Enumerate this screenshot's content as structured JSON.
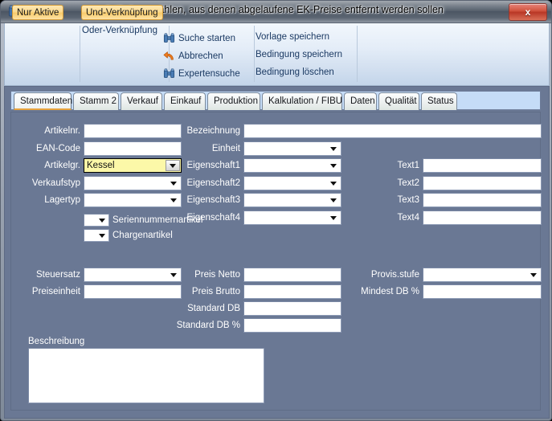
{
  "window": {
    "title": "Artikel auswählen, aus denen abgelaufene EK-Preise entfernt werden sollen",
    "app_icon": "binoculars-icon",
    "close_label": "x"
  },
  "ribbon": {
    "toggles": {
      "nur_aktive": "Nur Aktive",
      "und_verknuepfung": "Und-Verknüpfung",
      "oder_verknuepfung": "Oder-Verknüpfung"
    },
    "actions": [
      {
        "label": "Suche starten",
        "icon": "binoculars-icon"
      },
      {
        "label": "Abbrechen",
        "icon": "undo-arrow-icon"
      },
      {
        "label": "Expertensuche",
        "icon": "binoculars-icon"
      }
    ],
    "links": [
      {
        "label": "Vorlage speichern"
      },
      {
        "label": "Bedingung speichern"
      },
      {
        "label": "Bedingung löschen"
      }
    ]
  },
  "tabs": [
    {
      "label": "Stammdaten",
      "active": true
    },
    {
      "label": "Stamm 2",
      "active": false
    },
    {
      "label": "Verkauf",
      "active": false
    },
    {
      "label": "Einkauf",
      "active": false
    },
    {
      "label": "Produktion",
      "active": false
    },
    {
      "label": "Kalkulation / FIBU",
      "active": false
    },
    {
      "label": "Daten",
      "active": false
    },
    {
      "label": "Qualität",
      "active": false
    },
    {
      "label": "Status",
      "active": false
    }
  ],
  "form": {
    "col_left": [
      {
        "label": "Artikelnr.",
        "type": "text",
        "value": ""
      },
      {
        "label": "EAN-Code",
        "type": "text",
        "value": ""
      },
      {
        "label": "Artikelgr.",
        "type": "combo",
        "value": "Kessel",
        "highlighted": true
      },
      {
        "label": "Verkaufstyp",
        "type": "combo",
        "value": ""
      },
      {
        "label": "Lagertyp",
        "type": "combo",
        "value": ""
      }
    ],
    "flag_combos": [
      {
        "label": "Seriennummernartikel",
        "value": ""
      },
      {
        "label": "Chargenartikel",
        "value": ""
      }
    ],
    "col_mid": [
      {
        "label": "Bezeichnung",
        "type": "text",
        "value": ""
      },
      {
        "label": "Einheit",
        "type": "combo",
        "value": ""
      },
      {
        "label": "Eigenschaft1",
        "type": "combo",
        "value": ""
      },
      {
        "label": "Eigenschaft2",
        "type": "combo",
        "value": ""
      },
      {
        "label": "Eigenschaft3",
        "type": "combo",
        "value": ""
      },
      {
        "label": "Eigenschaft4",
        "type": "combo",
        "value": ""
      }
    ],
    "col_right": [
      {
        "label": "Text1",
        "type": "text",
        "value": ""
      },
      {
        "label": "Text2",
        "type": "text",
        "value": ""
      },
      {
        "label": "Text3",
        "type": "text",
        "value": ""
      },
      {
        "label": "Text4",
        "type": "text",
        "value": ""
      }
    ],
    "lower_left": [
      {
        "label": "Steuersatz",
        "type": "combo",
        "value": ""
      },
      {
        "label": "Preiseinheit",
        "type": "text",
        "value": ""
      }
    ],
    "lower_mid": [
      {
        "label": "Preis Netto",
        "type": "text",
        "value": ""
      },
      {
        "label": "Preis Brutto",
        "type": "text",
        "value": ""
      },
      {
        "label": "Standard DB",
        "type": "text",
        "value": ""
      },
      {
        "label": "Standard DB %",
        "type": "text",
        "value": ""
      }
    ],
    "lower_right": [
      {
        "label": "Provis.stufe",
        "type": "combo",
        "value": ""
      },
      {
        "label": "Mindest DB %",
        "type": "text",
        "value": ""
      }
    ],
    "description": {
      "label": "Beschreibung",
      "value": ""
    }
  },
  "colors": {
    "panel_bg": "#6a7894",
    "accent_orange": "#e8a33d",
    "highlight_yellow": "#fcf8a8",
    "link_blue": "#1b3a63",
    "tab_strip_bg": "#c5dcf7"
  }
}
